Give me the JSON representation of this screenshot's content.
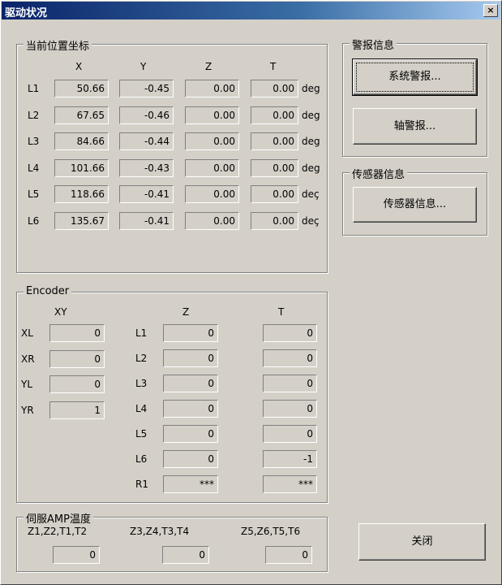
{
  "window": {
    "title": "驱动状况",
    "close_label": "×"
  },
  "position": {
    "legend": "当前位置坐标",
    "headers": [
      "X",
      "Y",
      "Z",
      "T"
    ],
    "unit": "deg",
    "unit_cut": "deç",
    "rows": [
      {
        "label": "L1",
        "x": "50.66",
        "y": "-0.45",
        "z": "0.00",
        "t": "0.00"
      },
      {
        "label": "L2",
        "x": "67.65",
        "y": "-0.46",
        "z": "0.00",
        "t": "0.00"
      },
      {
        "label": "L3",
        "x": "84.66",
        "y": "-0.44",
        "z": "0.00",
        "t": "0.00"
      },
      {
        "label": "L4",
        "x": "101.66",
        "y": "-0.43",
        "z": "0.00",
        "t": "0.00"
      },
      {
        "label": "L5",
        "x": "118.66",
        "y": "-0.41",
        "z": "0.00",
        "t": "0.00"
      },
      {
        "label": "L6",
        "x": "135.67",
        "y": "-0.41",
        "z": "0.00",
        "t": "0.00"
      }
    ]
  },
  "alarm": {
    "legend": "警报信息",
    "system_btn": "系统警报...",
    "axis_btn": "轴警报..."
  },
  "sensor": {
    "legend": "传感器信息",
    "btn": "传感器信息..."
  },
  "encoder": {
    "legend": "Encoder",
    "xy_header": "XY",
    "z_header": "Z",
    "t_header": "T",
    "xy": [
      {
        "label": "XL",
        "value": "0"
      },
      {
        "label": "XR",
        "value": "0"
      },
      {
        "label": "YL",
        "value": "0"
      },
      {
        "label": "YR",
        "value": "1"
      }
    ],
    "zt": [
      {
        "label": "L1",
        "z": "0",
        "t": "0"
      },
      {
        "label": "L2",
        "z": "0",
        "t": "0"
      },
      {
        "label": "L3",
        "z": "0",
        "t": "0"
      },
      {
        "label": "L4",
        "z": "0",
        "t": "0"
      },
      {
        "label": "L5",
        "z": "0",
        "t": "0"
      },
      {
        "label": "L6",
        "z": "0",
        "t": "-1"
      },
      {
        "label": "R1",
        "z": "***",
        "t": "***"
      }
    ]
  },
  "amp": {
    "legend": "伺服AMP温度",
    "groups": [
      {
        "label": "Z1,Z2,T1,T2",
        "value": "0"
      },
      {
        "label": "Z3,Z4,T3,T4",
        "value": "0"
      },
      {
        "label": "Z5,Z6,T5,T6",
        "value": "0"
      }
    ]
  },
  "close_btn": "关闭"
}
